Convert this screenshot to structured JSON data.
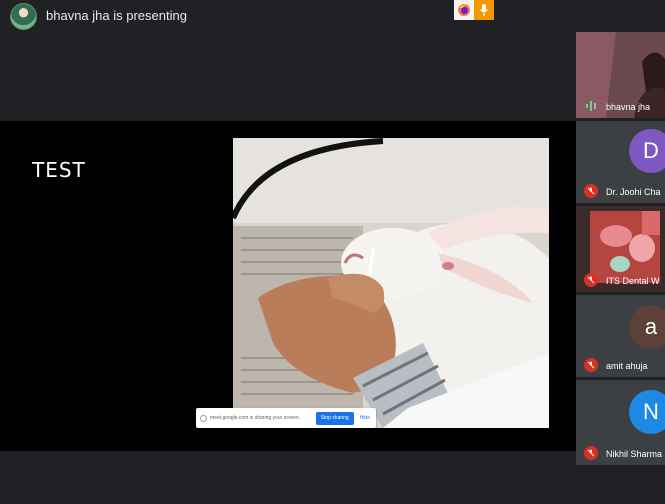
{
  "header": {
    "presenting_text": "bhavna jha is presenting",
    "pinned_icons": [
      "firefox-icon",
      "mic-icon"
    ]
  },
  "presentation": {
    "slide_title": "TEST",
    "share_bar": {
      "text": "meet.google.com is sharing your screen.",
      "stop_label": "Stop sharing",
      "hide_label": "Hide"
    }
  },
  "participants": [
    {
      "name": "bhavna jha",
      "type": "video",
      "status": "speaking"
    },
    {
      "name": "Dr. Joohi Cha",
      "type": "avatar",
      "initial": "D",
      "avatar_color": "#7e57c2",
      "status": "muted"
    },
    {
      "name": "ITS Dental W",
      "type": "video",
      "status": "muted"
    },
    {
      "name": "amit ahuja",
      "type": "avatar",
      "initial": "a",
      "avatar_color": "#5d4037",
      "status": "muted"
    },
    {
      "name": "Nikhil Sharma",
      "type": "avatar",
      "initial": "N",
      "avatar_color": "#1e88e5",
      "status": "muted"
    }
  ],
  "colors": {
    "background": "#202124",
    "stage": "#000000",
    "mute_red": "#d93025",
    "speaking_green": "#81c995",
    "stop_blue": "#1a73e8"
  }
}
